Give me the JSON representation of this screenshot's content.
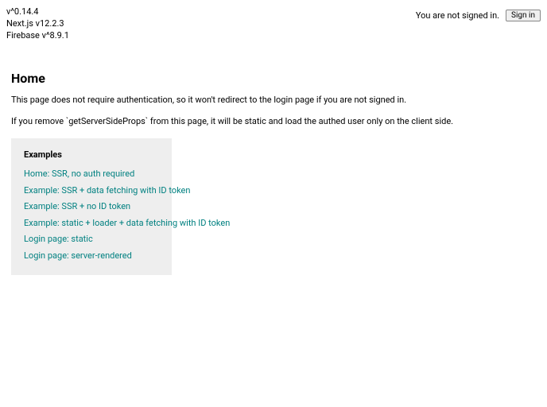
{
  "versions": {
    "lib": "v^0.14.4",
    "next": "Next.js v12.2.3",
    "firebase": "Firebase v^8.9.1"
  },
  "auth": {
    "status_text": "You are not signed in.",
    "signin_label": "Sign in"
  },
  "page": {
    "title": "Home",
    "para1": "This page does not require authentication, so it won't redirect to the login page if you are not signed in.",
    "para2": "If you remove `getServerSideProps` from this page, it will be static and load the authed user only on the client side."
  },
  "examples": {
    "heading": "Examples",
    "links": [
      "Home: SSR, no auth required",
      "Example: SSR + data fetching with ID token",
      "Example: SSR + no ID token",
      "Example: static + loader + data fetching with ID token",
      "Login page: static",
      "Login page: server-rendered"
    ]
  }
}
